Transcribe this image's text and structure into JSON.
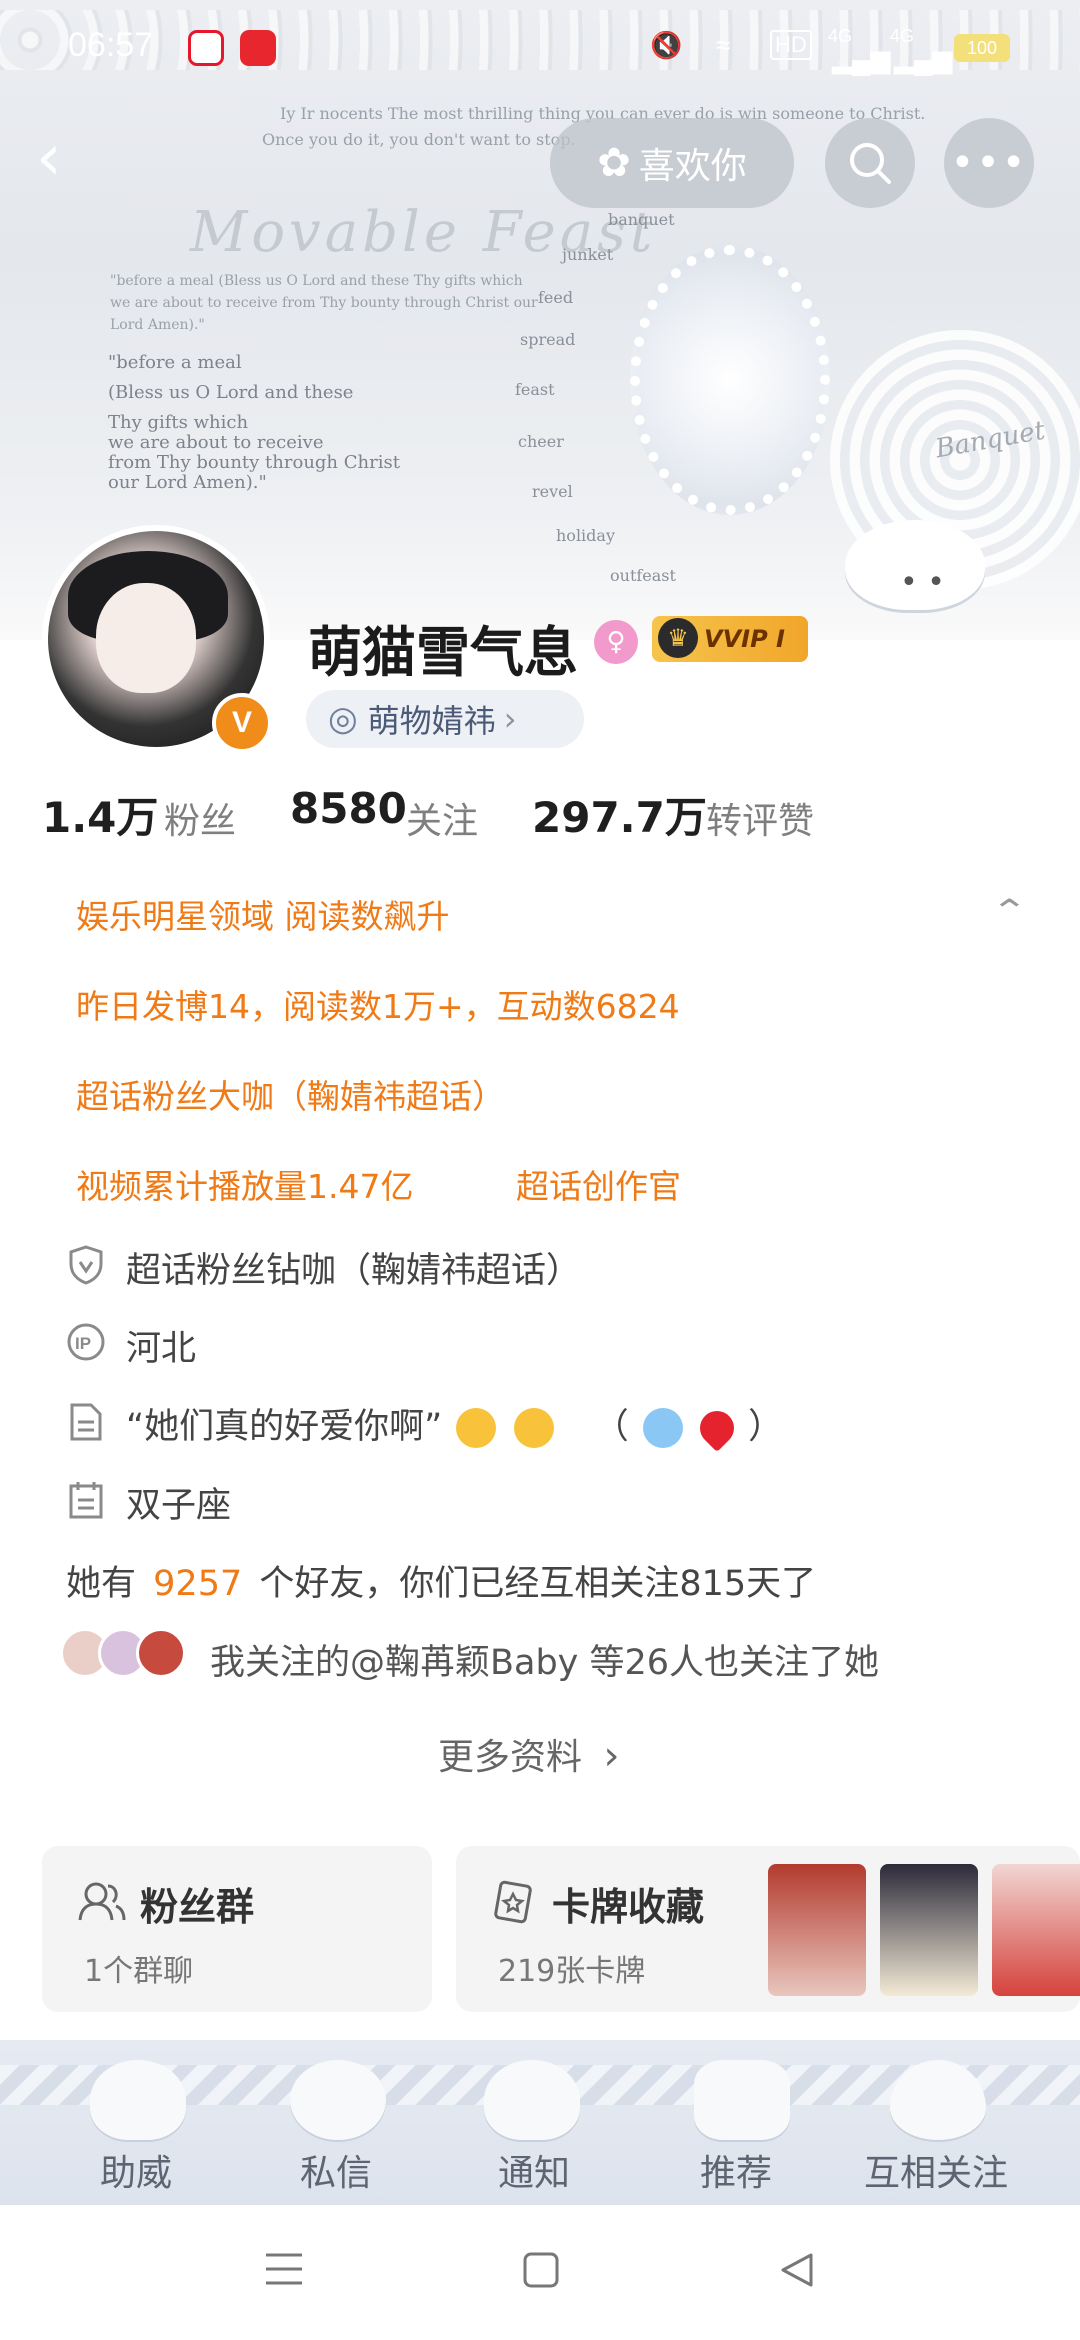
{
  "status_bar": {
    "time": "06:57",
    "battery": "100",
    "network_a": "4G",
    "network_b": "4G",
    "hd_label": "HD"
  },
  "hero": {
    "poem_line1": "Iy Ir nocents The most thrilling thing you can ever do is win someone to Christ.",
    "poem_line2": "Once you do it, you don't want to stop.",
    "title_script": "Movable Feast",
    "words": [
      "banquet",
      "junket",
      "feed",
      "spread",
      "feast",
      "cheer",
      "revel",
      "holiday",
      "outfeast"
    ],
    "prayer_small": "\"before a meal (Bless us O Lord and these Thy gifts which we are about to receive from Thy bounty through Christ our Lord Amen).\"",
    "prayer_l1": "\"before a meal",
    "prayer_l2": "(Bless us O Lord and these",
    "prayer_l3": "Thy gifts which",
    "prayer_l4": "we are about to receive",
    "prayer_l5": "from Thy bounty through Christ",
    "prayer_l6": "our Lord Amen).\"",
    "banquet_script": "Banquet"
  },
  "topnav": {
    "like_label": "喜欢你"
  },
  "profile": {
    "username": "萌猫雪气息",
    "vip_label": "VVIP I",
    "verified_letter": "V",
    "tag": "萌物婧祎",
    "tag_arrow": "›"
  },
  "stats": [
    {
      "value": "1.4万",
      "label": "粉丝"
    },
    {
      "value": "8580",
      "label": "关注"
    },
    {
      "value": "297.7万",
      "label": "转评赞"
    }
  ],
  "highlights": {
    "line1": "娱乐明星领域 阅读数飙升",
    "line2": "昨日发博14，阅读数1万+，互动数6824",
    "line3": "超话粉丝大咖（鞠婧祎超话）",
    "line4a": "视频累计播放量1.47亿",
    "line4b": "超话创作官"
  },
  "info": {
    "badge": "超话粉丝钻咖（鞠婧祎超话）",
    "ip_location": "河北",
    "bio_text": "“她们真的好爱你啊”",
    "bio_paren_open": "（",
    "bio_paren_close": "）",
    "zodiac": "双子座",
    "friends_prefix": "她有",
    "friends_count": "9257",
    "friends_suffix": "个好友，你们已经互相关注815天了",
    "mutual": "我关注的@鞠苒颖Baby 等26人也关注了她",
    "more": "更多资料",
    "more_arrow": "›"
  },
  "cards": {
    "fan_group_title": "粉丝群",
    "fan_group_sub": "1个群聊",
    "cards_title": "卡牌收藏",
    "cards_sub": "219张卡牌"
  },
  "tabs": [
    "助威",
    "私信",
    "通知",
    "推荐",
    "互相关注"
  ],
  "colors": {
    "accent_orange": "#ef7a16",
    "verified_orange": "#f08c1a",
    "gender_pink": "#f19acb",
    "vip_gold": "#f6c44c"
  }
}
